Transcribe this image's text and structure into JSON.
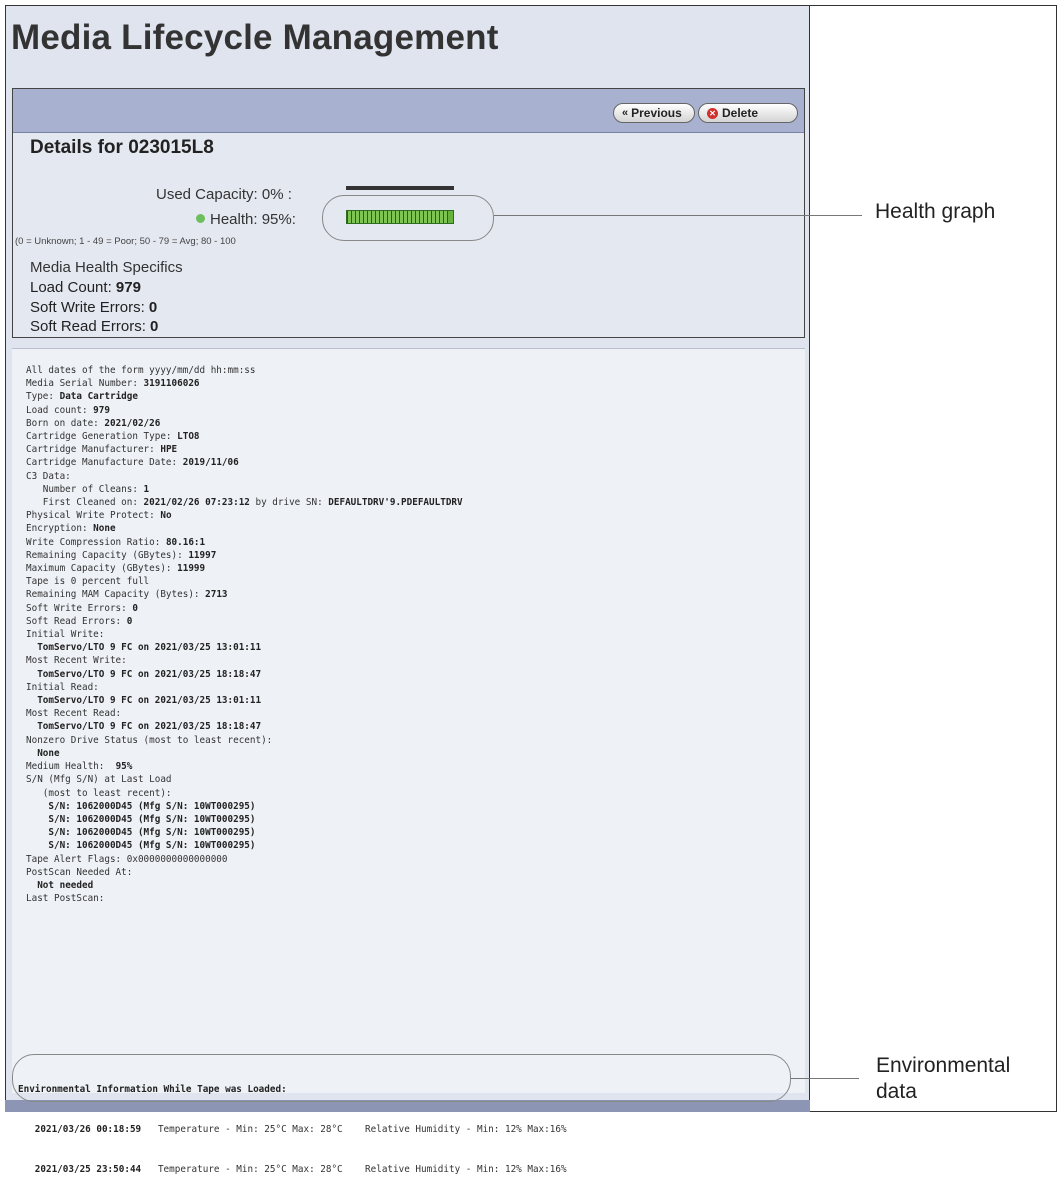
{
  "page": {
    "title": "Media Lifecycle Management"
  },
  "toolbar": {
    "previous_label": "Previous",
    "delete_label": "Delete"
  },
  "details": {
    "heading": "Details for 023015L8",
    "used_capacity_label": "Used Capacity: 0% :",
    "used_capacity_percent": 0,
    "health_label": "Health: 95%:",
    "health_percent": 95,
    "health_scale": "(0 = Unknown; 1 - 49 = Poor; 50 - 79 = Avg; 80 - 100",
    "specifics_title": "Media Health Specifics",
    "load_count_label": "Load Count: ",
    "load_count_value": "979",
    "soft_write_label": "Soft Write Errors: ",
    "soft_write_value": "0",
    "soft_read_label": "Soft Read Errors: ",
    "soft_read_value": "0"
  },
  "log_lines": [
    {
      "label": "All dates of the form yyyy/mm/dd hh:mm:ss",
      "value": ""
    },
    {
      "label": "Media Serial Number: ",
      "value": "3191106026"
    },
    {
      "label": "Type: ",
      "value": "Data Cartridge"
    },
    {
      "label": "Load count: ",
      "value": "979"
    },
    {
      "label": "Born on date: ",
      "value": "2021/02/26"
    },
    {
      "label": "Cartridge Generation Type: ",
      "value": "LTO8"
    },
    {
      "label": "Cartridge Manufacturer: ",
      "value": "HPE"
    },
    {
      "label": "Cartridge Manufacture Date: ",
      "value": "2019/11/06"
    },
    {
      "label": "C3 Data:",
      "value": ""
    },
    {
      "label": "   Number of Cleans: ",
      "value": "1"
    },
    {
      "label": "   First Cleaned on: ",
      "value": "2021/02/26 07:23:12",
      "label2": " by drive SN: ",
      "value2": "DEFAULTDRV'9.PDEFAULTDRV"
    },
    {
      "label": "Physical Write Protect: ",
      "value": "No"
    },
    {
      "label": "Encryption: ",
      "value": "None"
    },
    {
      "label": "Write Compression Ratio: ",
      "value": "80.16:1"
    },
    {
      "label": "Remaining Capacity (GBytes): ",
      "value": "11997"
    },
    {
      "label": "Maximum Capacity (GBytes): ",
      "value": "11999"
    },
    {
      "label": "Tape is 0 percent full",
      "value": ""
    },
    {
      "label": "Remaining MAM Capacity (Bytes): ",
      "value": "2713"
    },
    {
      "label": "Soft Write Errors: ",
      "value": "0"
    },
    {
      "label": "Soft Read Errors: ",
      "value": "0"
    },
    {
      "label": "Initial Write:",
      "value": ""
    },
    {
      "label": "  ",
      "value": "TomServo/LTO 9 FC on 2021/03/25 13:01:11"
    },
    {
      "label": "Most Recent Write:",
      "value": ""
    },
    {
      "label": "  ",
      "value": "TomServo/LTO 9 FC on 2021/03/25 18:18:47"
    },
    {
      "label": "Initial Read:",
      "value": ""
    },
    {
      "label": "  ",
      "value": "TomServo/LTO 9 FC on 2021/03/25 13:01:11"
    },
    {
      "label": "Most Recent Read:",
      "value": ""
    },
    {
      "label": "  ",
      "value": "TomServo/LTO 9 FC on 2021/03/25 18:18:47"
    },
    {
      "label": "Nonzero Drive Status (most to least recent):",
      "value": ""
    },
    {
      "label": "  ",
      "value": "None"
    },
    {
      "label": "Medium Health:  ",
      "value": "95%"
    },
    {
      "label": "S/N (Mfg S/N) at Last Load",
      "value": ""
    },
    {
      "label": "   (most to least recent):",
      "value": ""
    },
    {
      "label": "    ",
      "value": "S/N: 1062000D45 (Mfg S/N: 10WT000295)"
    },
    {
      "label": "    ",
      "value": "S/N: 1062000D45 (Mfg S/N: 10WT000295)"
    },
    {
      "label": "    ",
      "value": "S/N: 1062000D45 (Mfg S/N: 10WT000295)"
    },
    {
      "label": "    ",
      "value": "S/N: 1062000D45 (Mfg S/N: 10WT000295)"
    },
    {
      "label": "Tape Alert Flags: 0x0000000000000000",
      "value": ""
    },
    {
      "label": "PostScan Needed At:",
      "value": ""
    },
    {
      "label": "  ",
      "value": "Not needed"
    },
    {
      "label": "Last PostScan:",
      "value": ""
    }
  ],
  "environment": {
    "title": "Environmental Information While Tape was Loaded:",
    "rows": [
      {
        "date": "2021/03/26 00:18:59",
        "text": "   Temperature - Min: 25°C Max: 28°C    Relative Humidity - Min: 12% Max:16%"
      },
      {
        "date": "2021/03/25 23:50:44",
        "text": "   Temperature - Min: 25°C Max: 28°C    Relative Humidity - Min: 12% Max:16%"
      }
    ]
  },
  "callouts": {
    "health_graph": "Health graph",
    "environmental_line1": "Environmental",
    "environmental_line2": "data"
  }
}
